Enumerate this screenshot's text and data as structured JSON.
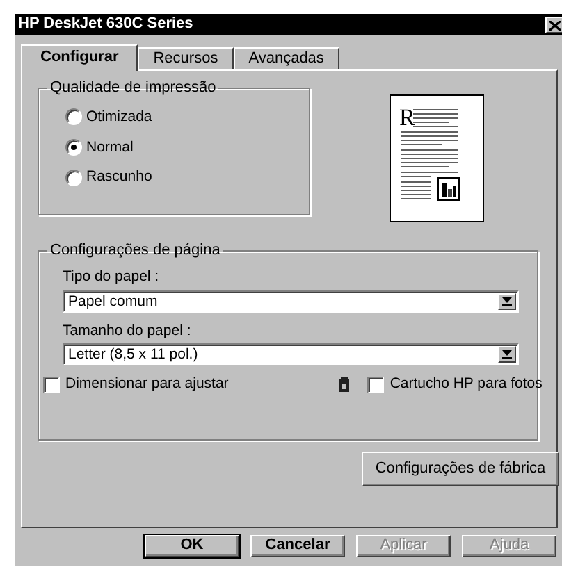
{
  "window": {
    "title": "HP DeskJet 630C Series"
  },
  "tabs": [
    {
      "label": "Configurar",
      "selected": true
    },
    {
      "label": "Recursos",
      "selected": false
    },
    {
      "label": "Avançadas",
      "selected": false
    }
  ],
  "quality": {
    "title": "Qualidade de impressão",
    "options": [
      {
        "label": "Otimizada",
        "selected": false
      },
      {
        "label": "Normal",
        "selected": true
      },
      {
        "label": "Rascunho",
        "selected": false
      }
    ]
  },
  "page_settings": {
    "title": "Configurações de página",
    "fields": [
      {
        "label": "Tipo do papel :",
        "value": "Papel comum"
      },
      {
        "label": "Tamanho do papel :",
        "value": "Letter (8,5 x 11 pol.)"
      }
    ],
    "checkboxes": [
      {
        "label": "Dimensionar para ajustar",
        "checked": false,
        "kind": "plain"
      },
      {
        "label": "Cartucho HP para fotos",
        "checked": false,
        "kind": "cartridge"
      }
    ]
  },
  "preview": {
    "initial": "R"
  },
  "factory_button": "Configurações de fábrica",
  "buttons": [
    {
      "label": "OK",
      "disabled": false,
      "default": true
    },
    {
      "label": "Cancelar",
      "disabled": false,
      "default": false
    },
    {
      "label": "Aplicar",
      "disabled": true,
      "default": false
    },
    {
      "label": "Ajuda",
      "disabled": true,
      "default": false
    }
  ]
}
